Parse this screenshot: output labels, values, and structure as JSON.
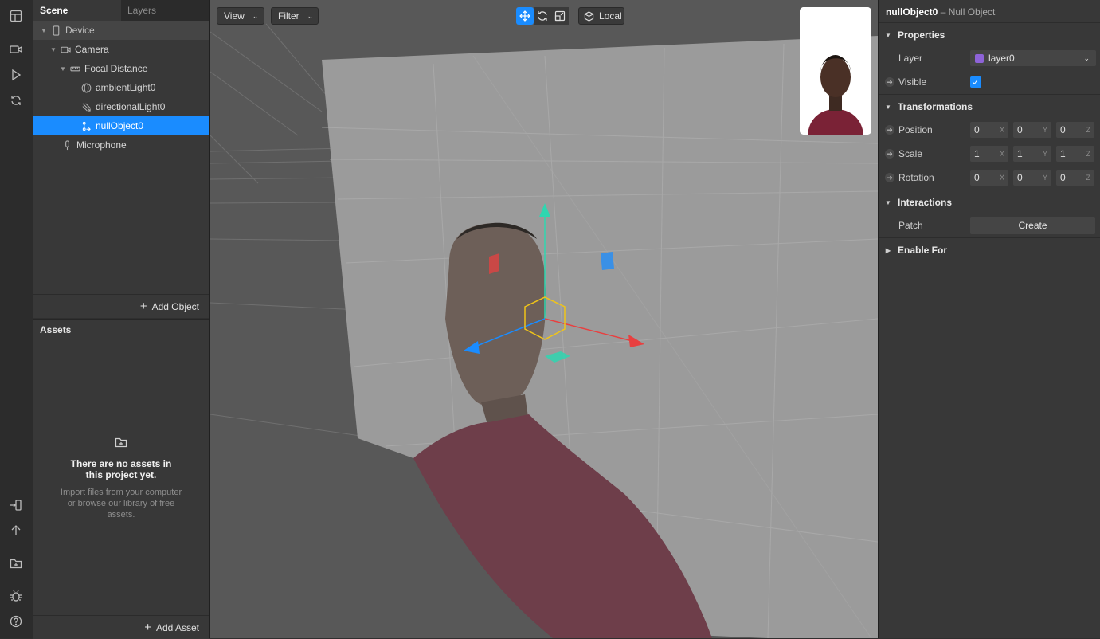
{
  "scene_tabs": {
    "scene": "Scene",
    "layers": "Layers"
  },
  "tree": [
    {
      "label": "Device",
      "icon": "phone-icon"
    },
    {
      "label": "Camera",
      "icon": "camera-icon"
    },
    {
      "label": "Focal Distance",
      "icon": "ruler-icon"
    },
    {
      "label": "ambientLight0",
      "icon": "globe-icon"
    },
    {
      "label": "directionalLight0",
      "icon": "directional-light-icon"
    },
    {
      "label": "nullObject0",
      "icon": "null-object-icon"
    },
    {
      "label": "Microphone",
      "icon": "microphone-icon"
    }
  ],
  "add_object": "Add Object",
  "assets": {
    "title": "Assets",
    "empty_title": "There are no assets in this project yet.",
    "empty_text": "Import files from your computer or browse our library of free assets.",
    "add_asset": "Add Asset"
  },
  "viewport": {
    "view": "View",
    "filter": "Filter",
    "space": "Local"
  },
  "inspector": {
    "object_name": "nullObject0",
    "object_type": "– Null Object",
    "sections": {
      "properties": "Properties",
      "transformations": "Transformations",
      "interactions": "Interactions",
      "enable_for": "Enable For"
    },
    "layer_label": "Layer",
    "layer_value": "layer0",
    "layer_color": "#8e63d8",
    "visible_label": "Visible",
    "visible": true,
    "position_label": "Position",
    "position": [
      "0",
      "0",
      "0"
    ],
    "scale_label": "Scale",
    "scale": [
      "1",
      "1",
      "1"
    ],
    "rotation_label": "Rotation",
    "rotation": [
      "0",
      "0",
      "0"
    ],
    "axis": [
      "X",
      "Y",
      "Z"
    ],
    "patch_label": "Patch",
    "create": "Create"
  },
  "colors": {
    "accent": "#1a8cff",
    "gizmo_x": "#e84040",
    "gizmo_y": "#2fd6b0",
    "gizmo_z": "#1a8cff"
  }
}
